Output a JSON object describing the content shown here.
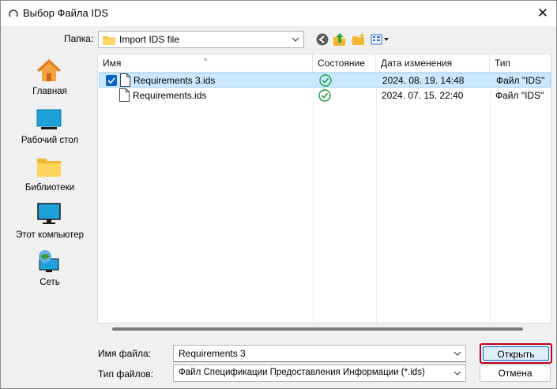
{
  "window": {
    "title": "Выбор Файла IDS",
    "close_glyph": "✕"
  },
  "toolbar": {
    "lookin_label": "Папка:",
    "lookin_value": "Import IDS file",
    "icons": [
      "back-icon",
      "up-folder-icon",
      "new-folder-icon",
      "view-menu-icon"
    ]
  },
  "places": [
    {
      "label": "Главная",
      "icon": "home-icon"
    },
    {
      "label": "Рабочий стол",
      "icon": "desktop-icon"
    },
    {
      "label": "Библиотеки",
      "icon": "libraries-folder-icon"
    },
    {
      "label": "Этот компьютер",
      "icon": "computer-icon"
    },
    {
      "label": "Сеть",
      "icon": "network-icon"
    }
  ],
  "filelist": {
    "columns": [
      "Имя",
      "Состояние",
      "Дата изменения",
      "Тип"
    ],
    "rows": [
      {
        "name": "Requirements 3.ids",
        "date": "2024. 08. 19. 14:48",
        "type": "Файл \"IDS\"",
        "selected": true
      },
      {
        "name": "Requirements.ids",
        "date": "2024. 07. 15. 22:40",
        "type": "Файл \"IDS\"",
        "selected": false
      }
    ]
  },
  "footer": {
    "filename_label": "Имя файла:",
    "filename_value": "Requirements 3",
    "filetype_label": "Тип файлов:",
    "filetype_value": "Файл Спецификации Предоставления Информации (*.ids)",
    "open_label": "Открыть",
    "cancel_label": "Отмена"
  },
  "colors": {
    "accent": "#0a64c8",
    "selection": "#cce8ff",
    "highlight_border": "#c00018",
    "status_ok": "#1e9e3c"
  }
}
